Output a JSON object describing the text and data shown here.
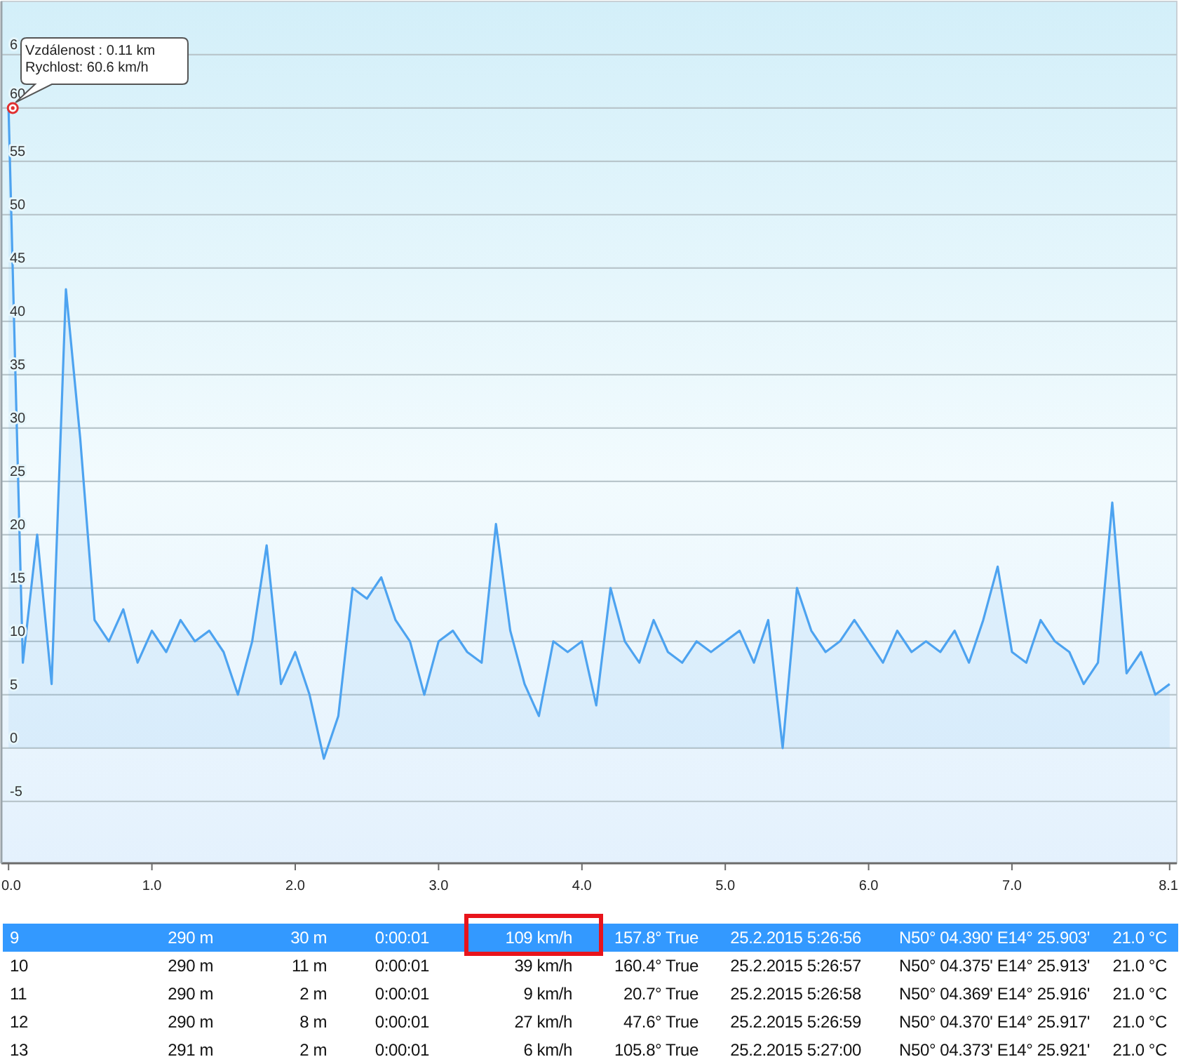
{
  "chart": {
    "chart_data": {
      "type": "area",
      "x": [
        0,
        0.1,
        0.2,
        0.3,
        0.4,
        0.5,
        0.6,
        0.7,
        0.8,
        0.9,
        1,
        1.1,
        1.2,
        1.3,
        1.4,
        1.5,
        1.6,
        1.7,
        1.8,
        1.9,
        2,
        2.1,
        2.2,
        2.3,
        2.4,
        2.5,
        2.6,
        2.7,
        2.8,
        2.9,
        3,
        3.1,
        3.2,
        3.3,
        3.4,
        3.5,
        3.6,
        3.7,
        3.8,
        3.9,
        4,
        4.1,
        4.2,
        4.3,
        4.4,
        4.5,
        4.6,
        4.7,
        4.8,
        4.9,
        5,
        5.1,
        5.2,
        5.3,
        5.4,
        5.5,
        5.6,
        5.7,
        5.8,
        5.9,
        6,
        6.1,
        6.2,
        6.3,
        6.4,
        6.5,
        6.6,
        6.7,
        6.8,
        6.9,
        7,
        7.1,
        7.2,
        7.3,
        7.4,
        7.5,
        7.6,
        7.7,
        7.8,
        7.9,
        8,
        8.1
      ],
      "series": [
        {
          "color": "#4da3f0",
          "values": [
            60,
            8,
            20,
            6,
            43,
            29,
            12,
            10,
            13,
            8,
            11,
            9,
            12,
            10,
            11,
            9,
            5,
            10,
            19,
            6,
            9,
            5,
            -1,
            3,
            15,
            14,
            16,
            12,
            10,
            5,
            10,
            11,
            9,
            8,
            21,
            11,
            6,
            3,
            10,
            9,
            10,
            4,
            15,
            10,
            8,
            12,
            9,
            8,
            10,
            9,
            10,
            11,
            8,
            12,
            0,
            15,
            11,
            9,
            10,
            12,
            10,
            8,
            11,
            9,
            10,
            9,
            11,
            8,
            12,
            17,
            9,
            8,
            12,
            10,
            9,
            6,
            8,
            23,
            7,
            9,
            5,
            6
          ]
        }
      ],
      "xlim": [
        -0.05,
        8.15
      ],
      "ylim": [
        -10.8,
        69.6
      ],
      "grid": true,
      "xticks": [
        {
          "value": 0,
          "label": "0.0"
        },
        {
          "value": 1,
          "label": "1.0"
        },
        {
          "value": 2,
          "label": "2.0"
        },
        {
          "value": 3,
          "label": "3.0"
        },
        {
          "value": 4,
          "label": "4.0"
        },
        {
          "value": 5,
          "label": "5.0"
        },
        {
          "value": 6,
          "label": "6.0"
        },
        {
          "value": 7,
          "label": "7.0"
        },
        {
          "value": 8.1,
          "label": "8.1"
        }
      ],
      "yticks": [
        -5,
        0,
        5,
        10,
        15,
        20,
        25,
        30,
        35,
        40,
        45,
        50,
        55,
        60
      ]
    },
    "cut_tick_label": "6",
    "tooltip": {
      "lines": [
        "Vzdálenost : 0.11 km",
        "Rychlost: 60.6 km/h"
      ]
    }
  },
  "table": {
    "rows": [
      {
        "selected": true,
        "cells": [
          {
            "text": "9",
            "outlined": false
          },
          {
            "text": "290 m",
            "outlined": false
          },
          {
            "text": "30 m",
            "outlined": false
          },
          {
            "text": "0:00:01",
            "outlined": false
          },
          {
            "text": "109 km/h",
            "outlined": true
          },
          {
            "text": "157.8° True",
            "outlined": false
          },
          {
            "text": "25.2.2015 5:26:56",
            "outlined": false
          },
          {
            "text": "N50° 04.390' E14° 25.903'",
            "outlined": false
          },
          {
            "text": "21.0 °C",
            "outlined": false
          }
        ]
      },
      {
        "selected": false,
        "cells": [
          {
            "text": "10",
            "outlined": false
          },
          {
            "text": "290 m",
            "outlined": false
          },
          {
            "text": "11 m",
            "outlined": false
          },
          {
            "text": "0:00:01",
            "outlined": false
          },
          {
            "text": "39 km/h",
            "outlined": false
          },
          {
            "text": "160.4° True",
            "outlined": false
          },
          {
            "text": "25.2.2015 5:26:57",
            "outlined": false
          },
          {
            "text": "N50° 04.375' E14° 25.913'",
            "outlined": false
          },
          {
            "text": "21.0 °C",
            "outlined": false
          }
        ]
      },
      {
        "selected": false,
        "cells": [
          {
            "text": "11",
            "outlined": false
          },
          {
            "text": "290 m",
            "outlined": false
          },
          {
            "text": "2 m",
            "outlined": false
          },
          {
            "text": "0:00:01",
            "outlined": false
          },
          {
            "text": "9 km/h",
            "outlined": false
          },
          {
            "text": "20.7° True",
            "outlined": false
          },
          {
            "text": "25.2.2015 5:26:58",
            "outlined": false
          },
          {
            "text": "N50° 04.369' E14° 25.916'",
            "outlined": false
          },
          {
            "text": "21.0 °C",
            "outlined": false
          }
        ]
      },
      {
        "selected": false,
        "cells": [
          {
            "text": "12",
            "outlined": false
          },
          {
            "text": "290 m",
            "outlined": false
          },
          {
            "text": "8 m",
            "outlined": false
          },
          {
            "text": "0:00:01",
            "outlined": false
          },
          {
            "text": "27 km/h",
            "outlined": false
          },
          {
            "text": "47.6° True",
            "outlined": false
          },
          {
            "text": "25.2.2015 5:26:59",
            "outlined": false
          },
          {
            "text": "N50° 04.370' E14° 25.917'",
            "outlined": false
          },
          {
            "text": "21.0 °C",
            "outlined": false
          }
        ]
      },
      {
        "selected": false,
        "cells": [
          {
            "text": "13",
            "outlined": false
          },
          {
            "text": "291 m",
            "outlined": false
          },
          {
            "text": "2 m",
            "outlined": false
          },
          {
            "text": "0:00:01",
            "outlined": false
          },
          {
            "text": "6 km/h",
            "outlined": false
          },
          {
            "text": "105.8° True",
            "outlined": false
          },
          {
            "text": "25.2.2015 5:27:00",
            "outlined": false
          },
          {
            "text": "N50° 04.373' E14° 25.921'",
            "outlined": false
          },
          {
            "text": "21.0 °C",
            "outlined": false
          }
        ]
      }
    ]
  }
}
